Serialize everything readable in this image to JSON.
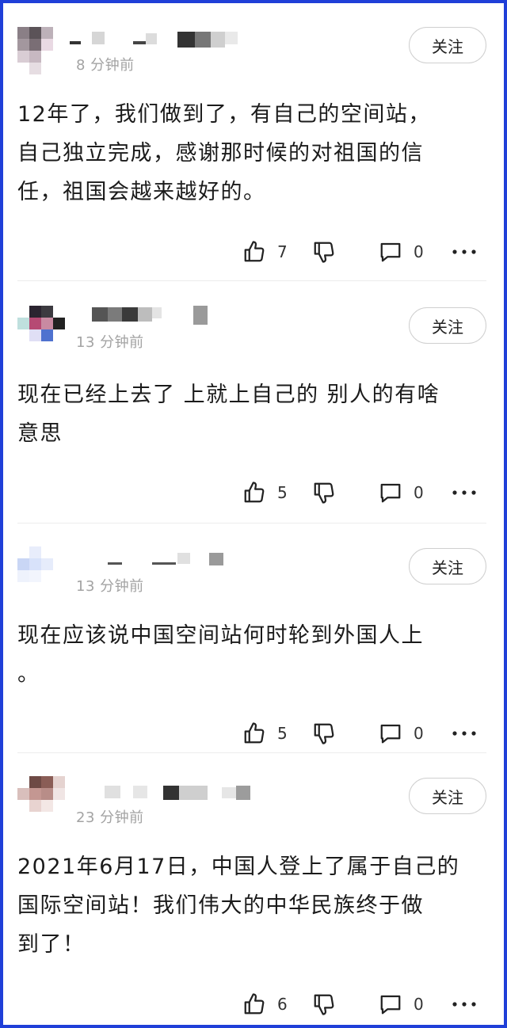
{
  "colors": {
    "frame_border": "#1f3fd8",
    "text": "#1b1b1b",
    "meta": "#a3a3a3"
  },
  "icons": {
    "like": "thumbs-up-icon",
    "dislike": "thumbs-down-icon",
    "reply": "comment-icon",
    "more": "more-icon"
  },
  "comments": [
    {
      "time": "8 分钟前",
      "follow_label": "关注",
      "text": "12年了，我们做到了，有自己的空间站，\n自己独立完成，感谢那时候的对祖国的信\n任，祖国会越来越好的。",
      "likes": "7",
      "replies": "0"
    },
    {
      "time": "13 分钟前",
      "follow_label": "关注",
      "text": "现在已经上去了 上就上自己的 别人的有啥\n意思",
      "likes": "5",
      "replies": "0"
    },
    {
      "time": "13 分钟前",
      "follow_label": "关注",
      "text": "现在应该说中国空间站何时轮到外国人上\n。",
      "likes": "5",
      "replies": "0"
    },
    {
      "time": "23 分钟前",
      "follow_label": "关注",
      "text": "2021年6月17日，中国人登上了属于自己的\n国际空间站！我们伟大的中华民族终于做\n到了！",
      "likes": "6",
      "replies": "0"
    }
  ]
}
